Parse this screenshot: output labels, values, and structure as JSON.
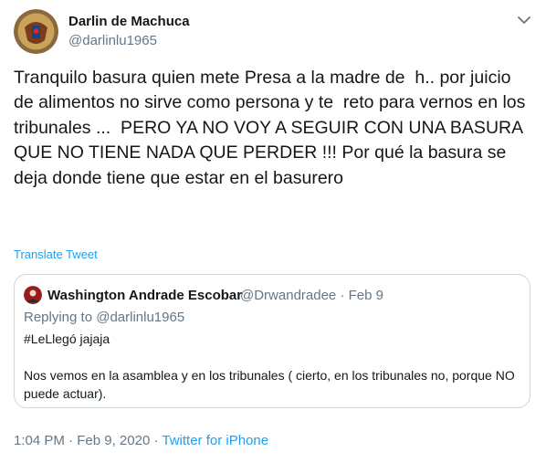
{
  "author": {
    "name": "Darlin de Machuca",
    "handle": "@darlinlu1965",
    "avatar_icon": "profile-photo"
  },
  "tweet": {
    "text": "Tranquilo basura quien mete Presa a la madre de  h.. por juicio de alimentos no sirve como persona y te  reto para vernos en los tribunales ...  PERO YA NO VOY A SEGUIR CON UNA BASURA QUE NO TIENE NADA QUE PERDER !!! Por qué la basura se deja donde tiene que estar en el basurero",
    "translate_label": "Translate Tweet"
  },
  "quoted": {
    "name": "Washington Andrade Escobar",
    "handle": "@Drwandradee",
    "separator": "·",
    "date": "Feb 9",
    "replying_prefix": "Replying to ",
    "replying_to": "@darlinlu1965",
    "hashtag_line": "#LeLlegó jajaja",
    "text": "Nos vemos en la asamblea y en los tribunales ( cierto, en los tribunales no, porque NO puede actuar)."
  },
  "meta": {
    "time": "1:04 PM",
    "separator": "·",
    "date": "Feb 9, 2020",
    "source": "Twitter for iPhone"
  },
  "colors": {
    "link": "#1da1f2",
    "secondary_text": "#657786",
    "border": "#ccd6dd"
  },
  "icons": {
    "menu": "chevron-down-icon"
  }
}
